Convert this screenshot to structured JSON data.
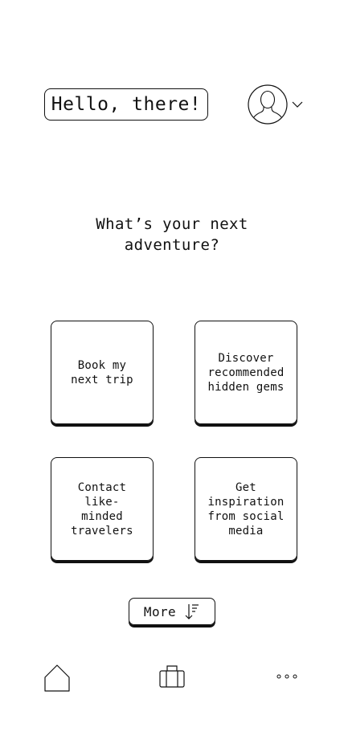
{
  "header": {
    "greeting": "Hello, there!",
    "profile_icon": "avatar-icon",
    "dropdown_icon": "chevron-down-icon"
  },
  "prompt": {
    "question": "What’s your next\nadventure?"
  },
  "options": [
    {
      "label": "Book my\nnext trip"
    },
    {
      "label": "Discover\nrecommended\nhidden gems"
    },
    {
      "label": "Contact\nlike-\nminded\ntravelers"
    },
    {
      "label": "Get\ninspiration\nfrom social\nmedia"
    }
  ],
  "more_button": {
    "label": "More",
    "icon": "sort-descending-icon"
  },
  "bottom_nav": {
    "items": [
      {
        "icon": "home-icon"
      },
      {
        "icon": "briefcase-icon"
      },
      {
        "icon": "more-dots-icon"
      }
    ]
  },
  "colors": {
    "background": "#ffffff",
    "stroke": "#111111"
  }
}
